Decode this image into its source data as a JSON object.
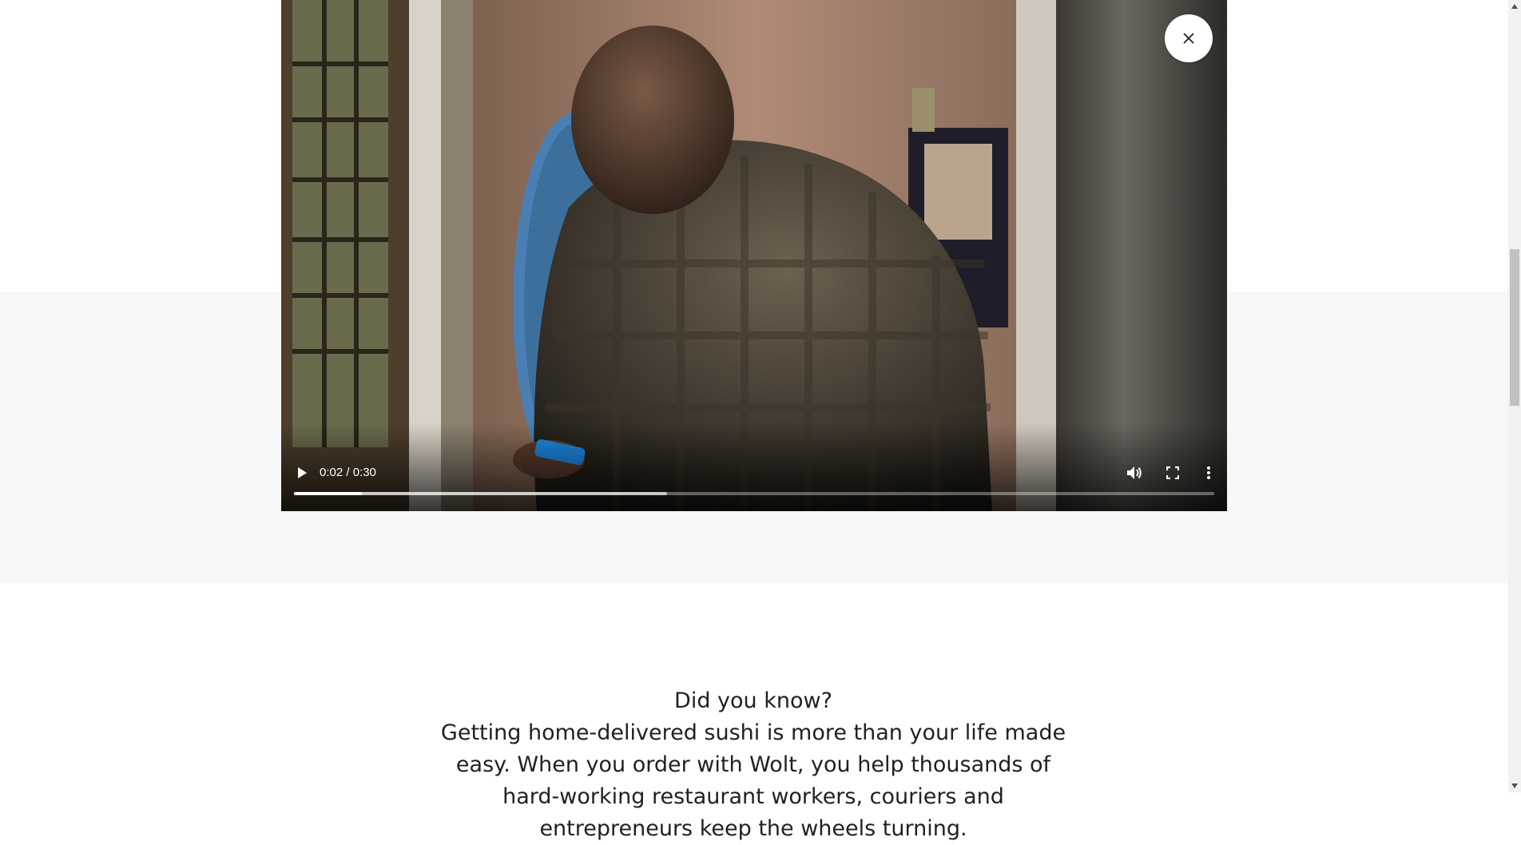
{
  "video": {
    "time_display": "0:02 / 0:30",
    "played_fraction": 0.074,
    "buffered_fraction": 0.405,
    "icons": {
      "play": "play-icon",
      "volume": "volume-icon",
      "fullscreen": "fullscreen-icon",
      "more": "more-vertical-icon",
      "close": "close-icon"
    }
  },
  "fact": {
    "heading": "Did you know?",
    "body": "Getting home-delivered sushi is more than your life made easy. When you order with Wolt, you help thousands of hard-working restaurant workers, couriers and entrepreneurs keep the wheels turning."
  },
  "colors": {
    "page_bg": "#ffffff",
    "section_gray": "#f7f7f7",
    "text": "#202125"
  }
}
